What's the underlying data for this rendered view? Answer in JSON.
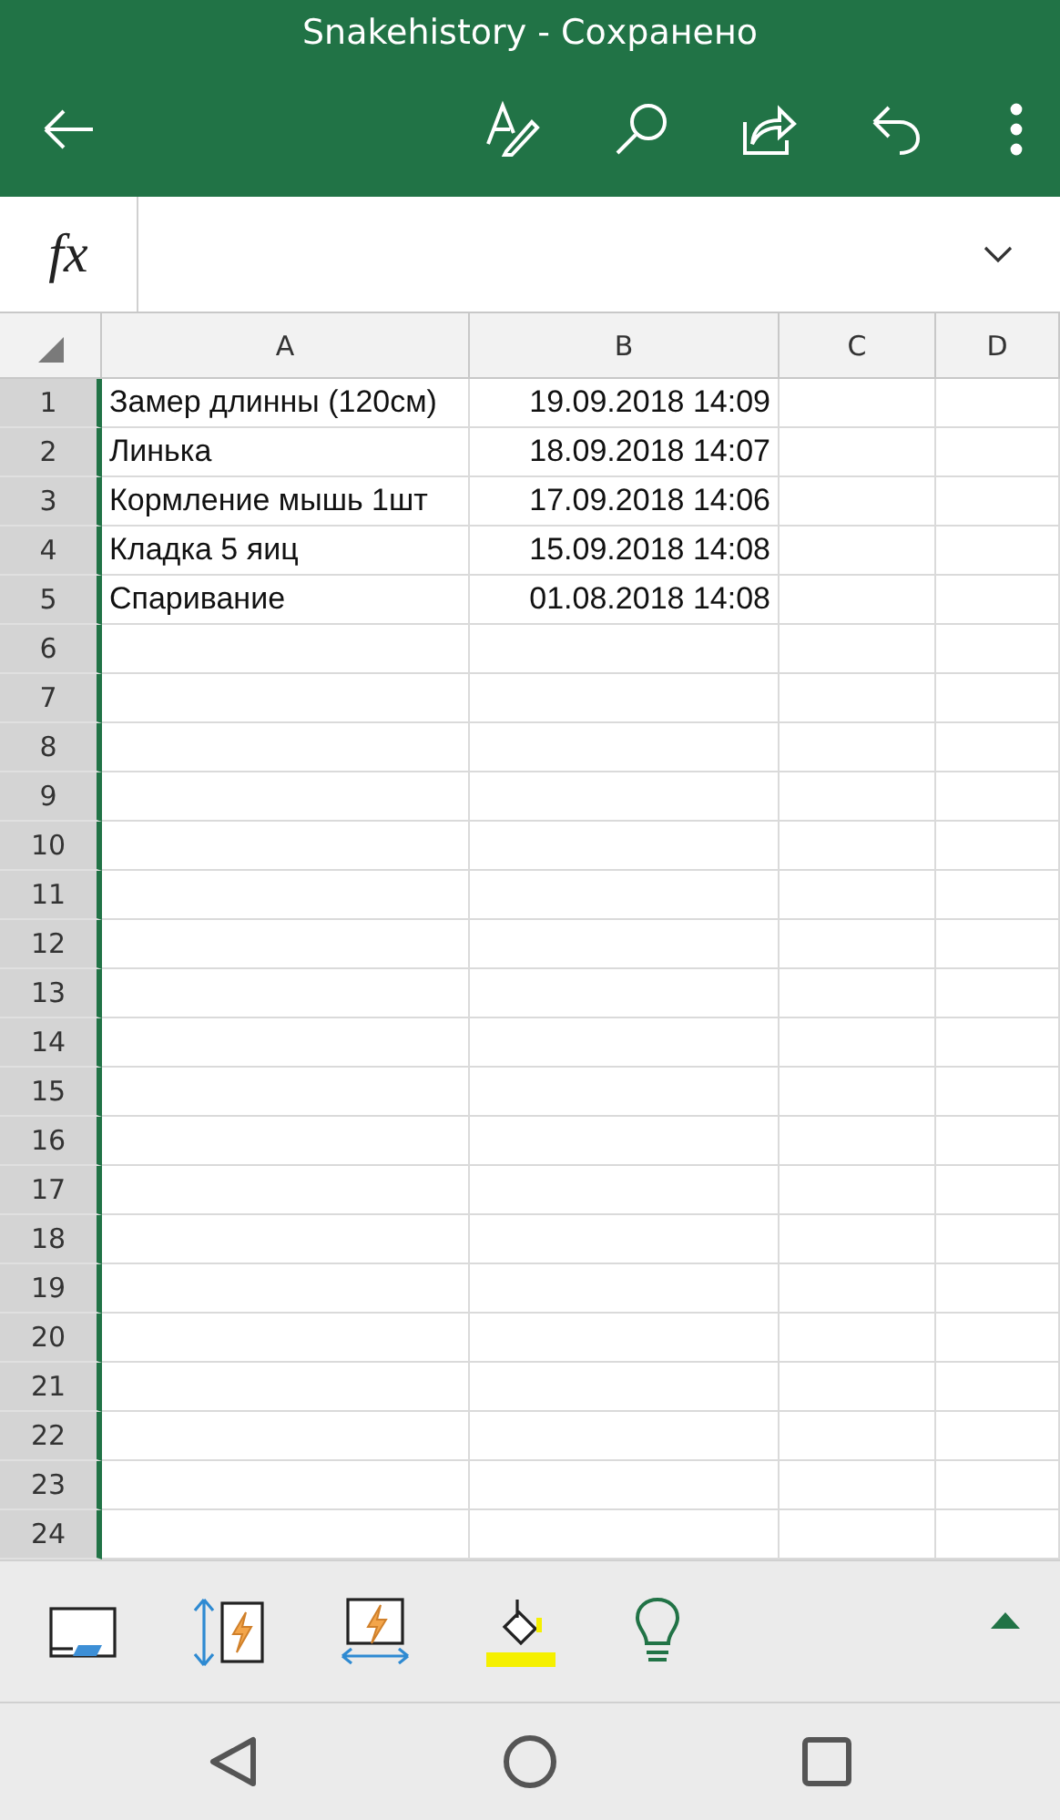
{
  "window": {
    "title": "Snakehistory - Сохранено"
  },
  "formula_bar": {
    "label": "fx"
  },
  "sheet": {
    "columns": [
      "A",
      "B",
      "C",
      "D"
    ],
    "rows": [
      {
        "number": "1",
        "cells": [
          "Замер длинны (120см)",
          "19.09.2018 14:09"
        ]
      },
      {
        "number": "2",
        "cells": [
          "Линька",
          "18.09.2018 14:07"
        ]
      },
      {
        "number": "3",
        "cells": [
          "Кормление мышь 1шт",
          "17.09.2018 14:06"
        ]
      },
      {
        "number": "4",
        "cells": [
          "Кладка 5 яиц",
          "15.09.2018 14:08"
        ]
      },
      {
        "number": "5",
        "cells": [
          "Спаривание",
          "01.08.2018 14:08"
        ]
      },
      {
        "number": "6"
      },
      {
        "number": "7"
      },
      {
        "number": "8"
      },
      {
        "number": "9"
      },
      {
        "number": "10"
      },
      {
        "number": "11"
      },
      {
        "number": "12"
      },
      {
        "number": "13"
      },
      {
        "number": "14"
      },
      {
        "number": "15"
      },
      {
        "number": "16"
      },
      {
        "number": "17"
      },
      {
        "number": "18"
      },
      {
        "number": "19"
      },
      {
        "number": "20"
      },
      {
        "number": "21"
      },
      {
        "number": "22"
      },
      {
        "number": "23"
      },
      {
        "number": "24"
      }
    ]
  }
}
